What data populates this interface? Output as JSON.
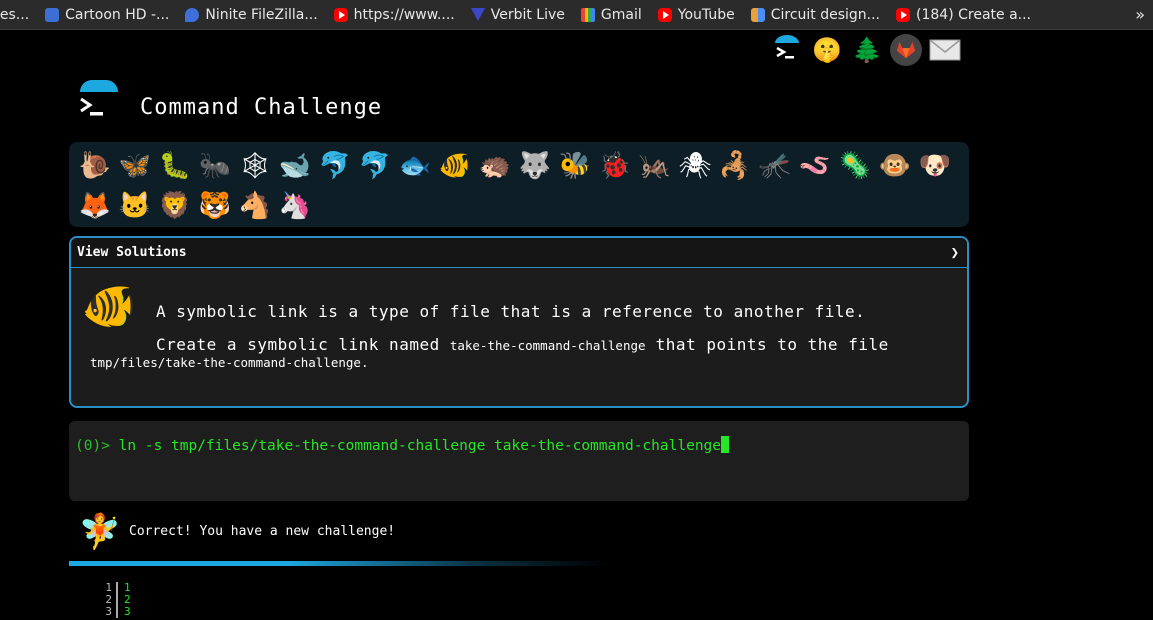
{
  "bookmarks": [
    {
      "label": "ies...",
      "icon": "none"
    },
    {
      "label": "Cartoon HD -...",
      "icon": "cartoon-hd-icon"
    },
    {
      "label": "Ninite FileZilla...",
      "icon": "ninite-icon"
    },
    {
      "label": "https://www....",
      "icon": "youtube-icon"
    },
    {
      "label": "Verbit Live",
      "icon": "verbit-icon"
    },
    {
      "label": "Gmail",
      "icon": "gmail-icon"
    },
    {
      "label": "YouTube",
      "icon": "youtube-icon"
    },
    {
      "label": "Circuit design...",
      "icon": "circuit-icon"
    },
    {
      "label": "(184) Create a...",
      "icon": "youtube-icon"
    }
  ],
  "bookmarks_more": "»",
  "top_icons": [
    "terminal-logo-icon",
    "shushing-face-icon",
    "tree-icon",
    "gitlab-icon",
    "mail-icon"
  ],
  "header": {
    "title": "Command Challenge"
  },
  "animals": [
    "🐌",
    "🦋",
    "🐛",
    "🐜",
    "🕸",
    "🐋",
    "🐬",
    "🐬",
    "🐟",
    "🐠",
    "🦔",
    "🐺",
    "🐝",
    "🐞",
    "🦗",
    "🕷",
    "🦂",
    "🦟",
    "🪱",
    "🦠",
    "🐵",
    "🐶",
    "🦊",
    "🐱",
    "🦁",
    "🐯",
    "🐴",
    "🦄"
  ],
  "panel": {
    "header": "View Solutions",
    "chevron": "❯",
    "line1": "A symbolic link is a type of file that is a reference to another file.",
    "line2_prefix": "Create a symbolic link named ",
    "line2_code": "take-the-command-challenge",
    "line2_suffix": " that points to the file",
    "line3_code": "tmp/files/take-the-command-challenge",
    "line3_suffix": "."
  },
  "terminal": {
    "prompt": "(0)>",
    "command": " ln -s tmp/files/take-the-command-challenge take-the-command-challenge"
  },
  "result": {
    "message": "Correct! You have a new challenge!"
  },
  "line_numbers": [
    {
      "num": "1",
      "val": "1"
    },
    {
      "num": "2",
      "val": "2"
    },
    {
      "num": "3",
      "val": "3"
    }
  ],
  "colors": {
    "accent": "#1ea8e0",
    "terminal_green": "#27e627",
    "panel_border": "#2a8fc4"
  }
}
